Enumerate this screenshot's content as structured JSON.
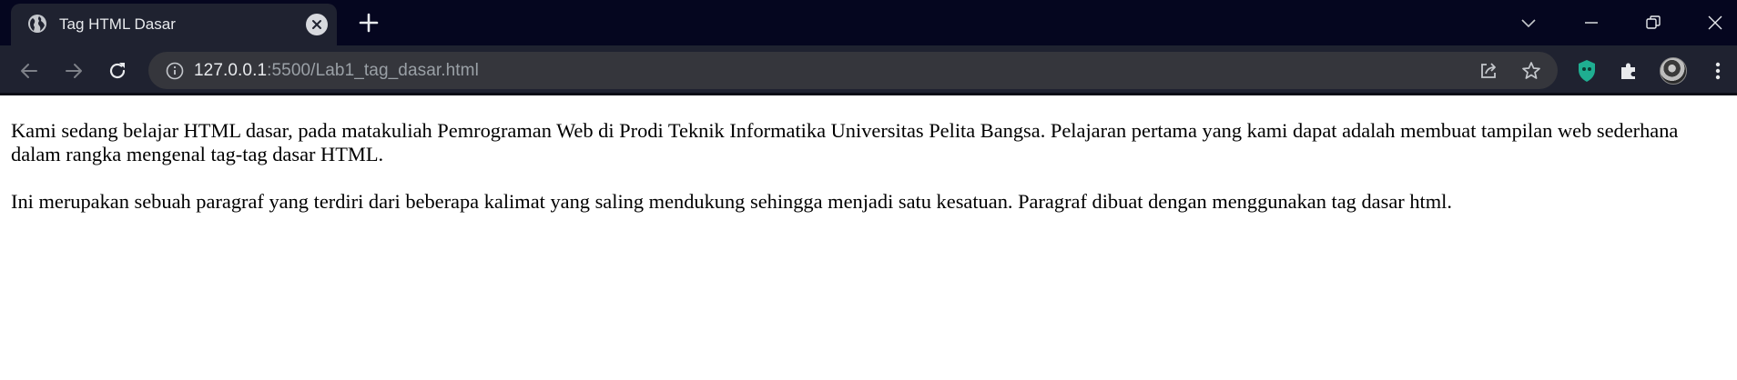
{
  "browser": {
    "tab": {
      "title": "Tag HTML Dasar",
      "favicon": "globe-icon"
    },
    "window_controls": [
      "chevron-down-icon",
      "minimize-icon",
      "restore-icon",
      "close-icon"
    ],
    "address_bar": {
      "url_host": "127.0.0.1",
      "url_rest": ":5500/Lab1_tag_dasar.html"
    },
    "colors": {
      "tabstrip_bg": "#05061f",
      "toolbar_bg": "#1f2230",
      "omnibox_bg": "#35363c",
      "extension_accent": "#1fae91"
    }
  },
  "page": {
    "paragraphs": [
      "Kami sedang belajar HTML dasar, pada matakuliah Pemrograman Web di Prodi Teknik Informatika Universitas Pelita Bangsa. Pelajaran pertama yang kami dapat adalah membuat tampilan web sederhana dalam rangka mengenal tag-tag dasar HTML.",
      "Ini merupakan sebuah paragraf yang terdiri dari beberapa kalimat yang saling mendukung sehingga menjadi satu kesatuan. Paragraf dibuat dengan menggunakan tag dasar html."
    ]
  }
}
